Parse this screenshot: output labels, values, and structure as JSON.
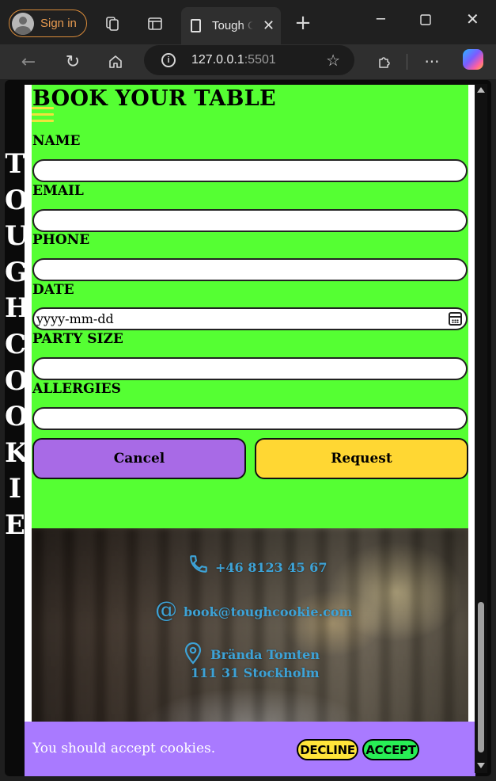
{
  "browser": {
    "sign_in_label": "Sign in",
    "tab_title": "Tough Cookie",
    "address_host": "127.0.0.1",
    "address_port": ":5501",
    "new_tab_symbol": "+"
  },
  "brand": {
    "vertical_title": [
      "T",
      "O",
      "U",
      "G",
      "H",
      " ",
      "C",
      "O",
      "O",
      "K",
      "I",
      "E"
    ]
  },
  "form": {
    "title": "BOOK YOUR TABLE",
    "name_label": "NAME",
    "email_label": "EMAIL",
    "phone_label": "PHONE",
    "date_label": "DATE",
    "date_value": "yyyy-mm-dd",
    "party_size_label": "PARTY SIZE",
    "allergies_label": "ALLERGIES",
    "cancel_label": "Cancel",
    "request_label": "Request"
  },
  "contact": {
    "phone": "+46 8123 45 67",
    "email": "book@toughcookie.com",
    "address_line1": "Brända Tomten",
    "address_line2": "111 31 Stockholm"
  },
  "cookie_banner": {
    "message": "You should accept cookies.",
    "decline_label": "DECLINE",
    "accept_label": "ACCEPT"
  },
  "colors": {
    "form_background": "#55ff33",
    "cancel_button": "#a86ae6",
    "request_button": "#ffd733",
    "contact_text": "#3da2d6",
    "cookie_banner": "#a97aff",
    "decline_button": "#ffe53a",
    "accept_button": "#28ee55"
  }
}
